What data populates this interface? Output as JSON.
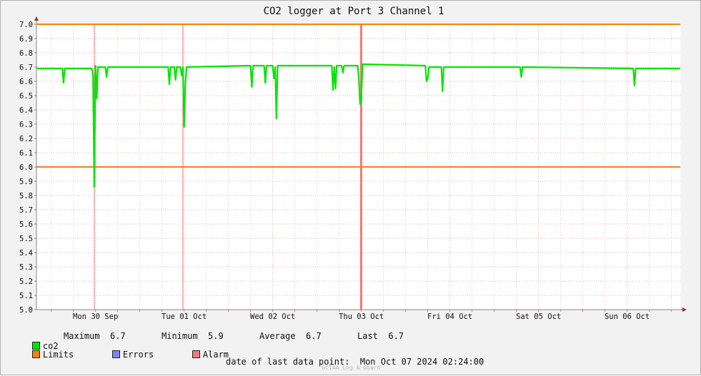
{
  "chart_data": {
    "type": "line",
    "title": "CO2 logger at Port 3 Channel 1",
    "xlabel": "",
    "ylabel": "",
    "x_range": [
      "2024-09-29T20:00",
      "2024-10-07T02:24"
    ],
    "ylim": [
      5.0,
      7.0
    ],
    "y_ticks": [
      "5.0",
      "5.1",
      "5.2",
      "5.3",
      "5.4",
      "5.5",
      "5.6",
      "5.7",
      "5.8",
      "5.9",
      "6.0",
      "6.1",
      "6.2",
      "6.3",
      "6.4",
      "6.5",
      "6.6",
      "6.7",
      "6.8",
      "6.9",
      "7.0"
    ],
    "x_tick_labels": [
      {
        "label": "Mon 30 Sep",
        "t": "2024-09-30T12:00"
      },
      {
        "label": "Tue 01 Oct",
        "t": "2024-10-01T12:00"
      },
      {
        "label": "Wed 02 Oct",
        "t": "2024-10-02T12:00"
      },
      {
        "label": "Thu 03 Oct",
        "t": "2024-10-03T12:00"
      },
      {
        "label": "Fri 04 Oct",
        "t": "2024-10-04T12:00"
      },
      {
        "label": "Sat 05 Oct",
        "t": "2024-10-05T12:00"
      },
      {
        "label": "Sun 06 Oct",
        "t": "2024-10-06T12:00"
      }
    ],
    "limits": [
      6.0,
      7.0
    ],
    "alarm_lines": [
      "2024-09-30T11:40",
      "2024-10-01T11:40"
    ],
    "alarm_bands": [
      [
        "2024-10-03T11:40",
        "2024-10-03T11:54"
      ]
    ],
    "series": [
      {
        "name": "co2",
        "color": "#00e600",
        "points": [
          [
            "2024-09-29T20:00",
            6.69
          ],
          [
            "2024-09-30T03:00",
            6.69
          ],
          [
            "2024-09-30T03:20",
            6.59
          ],
          [
            "2024-09-30T03:40",
            6.69
          ],
          [
            "2024-09-30T11:00",
            6.69
          ],
          [
            "2024-09-30T11:20",
            6.64
          ],
          [
            "2024-09-30T11:40",
            5.86
          ],
          [
            "2024-09-30T12:00",
            6.71
          ],
          [
            "2024-09-30T12:20",
            6.48
          ],
          [
            "2024-09-30T12:40",
            6.7
          ],
          [
            "2024-09-30T14:40",
            6.7
          ],
          [
            "2024-09-30T15:00",
            6.63
          ],
          [
            "2024-09-30T15:20",
            6.7
          ],
          [
            "2024-10-01T07:40",
            6.7
          ],
          [
            "2024-10-01T08:00",
            6.58
          ],
          [
            "2024-10-01T08:20",
            6.7
          ],
          [
            "2024-10-01T09:20",
            6.7
          ],
          [
            "2024-10-01T09:40",
            6.61
          ],
          [
            "2024-10-01T10:00",
            6.7
          ],
          [
            "2024-10-01T11:00",
            6.7
          ],
          [
            "2024-10-01T11:20",
            6.64
          ],
          [
            "2024-10-01T11:40",
            6.7
          ],
          [
            "2024-10-01T12:00",
            6.28
          ],
          [
            "2024-10-01T12:20",
            6.59
          ],
          [
            "2024-10-01T12:40",
            6.7
          ],
          [
            "2024-10-02T06:00",
            6.71
          ],
          [
            "2024-10-02T06:20",
            6.56
          ],
          [
            "2024-10-02T06:40",
            6.71
          ],
          [
            "2024-10-02T09:40",
            6.71
          ],
          [
            "2024-10-02T10:00",
            6.59
          ],
          [
            "2024-10-02T10:20",
            6.71
          ],
          [
            "2024-10-02T12:00",
            6.71
          ],
          [
            "2024-10-02T12:20",
            6.62
          ],
          [
            "2024-10-02T12:40",
            6.7
          ],
          [
            "2024-10-02T13:00",
            6.34
          ],
          [
            "2024-10-02T13:20",
            6.71
          ],
          [
            "2024-10-03T04:00",
            6.71
          ],
          [
            "2024-10-03T04:20",
            6.54
          ],
          [
            "2024-10-03T04:40",
            6.7
          ],
          [
            "2024-10-03T05:00",
            6.55
          ],
          [
            "2024-10-03T05:20",
            6.71
          ],
          [
            "2024-10-03T06:40",
            6.71
          ],
          [
            "2024-10-03T07:00",
            6.66
          ],
          [
            "2024-10-03T07:20",
            6.71
          ],
          [
            "2024-10-03T11:00",
            6.71
          ],
          [
            "2024-10-03T11:20",
            6.62
          ],
          [
            "2024-10-03T11:40",
            6.44
          ],
          [
            "2024-10-03T12:00",
            6.48
          ],
          [
            "2024-10-03T12:20",
            6.72
          ],
          [
            "2024-10-04T05:20",
            6.71
          ],
          [
            "2024-10-04T05:40",
            6.6
          ],
          [
            "2024-10-04T06:00",
            6.62
          ],
          [
            "2024-10-04T06:20",
            6.7
          ],
          [
            "2024-10-04T09:40",
            6.7
          ],
          [
            "2024-10-04T10:00",
            6.53
          ],
          [
            "2024-10-04T10:20",
            6.7
          ],
          [
            "2024-10-05T07:00",
            6.7
          ],
          [
            "2024-10-05T07:20",
            6.63
          ],
          [
            "2024-10-05T07:40",
            6.7
          ],
          [
            "2024-10-06T13:40",
            6.69
          ],
          [
            "2024-10-06T14:00",
            6.57
          ],
          [
            "2024-10-06T14:20",
            6.69
          ],
          [
            "2024-10-07T02:24",
            6.69
          ]
        ]
      }
    ]
  },
  "legend": {
    "co2_label": "co2",
    "maximum": "Maximum  6.7",
    "minimum": "Minimum  5.9",
    "average": "Average  6.7",
    "last": "Last  6.7",
    "limits_label": "Limits",
    "errors_label": "Errors",
    "alarm_label": "Alarm",
    "co2_color": "#00e600",
    "limits_color": "#ff7f0e",
    "errors_color": "#7b88f0",
    "alarm_color": "#f07878"
  },
  "footer": {
    "last_point": "date of last data point:  Mon Oct 07 2024 02:24:00",
    "watermark": "OCTAA Log & Guard"
  }
}
